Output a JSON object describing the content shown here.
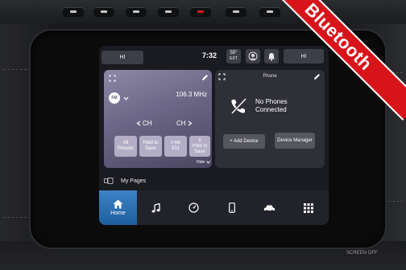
{
  "banner": {
    "label": "Bluetooth",
    "color": "#d8141b"
  },
  "bezel": {
    "label": "SCREEN OFF"
  },
  "status_bar": {
    "profile_label": "HI",
    "time": "7:32",
    "temperature": "55°",
    "temperature_unit": "EXT",
    "right_pill_label": "HI",
    "icons": [
      "driver-profile-icon",
      "notification-bell-icon"
    ]
  },
  "radio": {
    "band": "FM",
    "frequency": "106.3 MHz",
    "channel_down": "CH",
    "channel_up": "CH",
    "presets": [
      {
        "label": "All Presets"
      },
      {
        "label": "Hold to Save"
      },
      {
        "top": "2 AM",
        "label": "531"
      },
      {
        "top": "5",
        "label": "Hold to Save"
      }
    ],
    "hide_label": "Hide"
  },
  "phone": {
    "title": "Phone",
    "status": "No Phones Connected",
    "add_device": "+ Add Device",
    "device_manager": "Device Manager"
  },
  "my_pages": {
    "label": "My Pages"
  },
  "nav": {
    "active_color": "#2f74b8",
    "items": [
      {
        "label": "Home",
        "icon": "home-icon"
      },
      {
        "label": "",
        "icon": "music-note-icon"
      },
      {
        "label": "",
        "icon": "gauge-icon"
      },
      {
        "label": "",
        "icon": "phone-icon"
      },
      {
        "label": "",
        "icon": "car-icon"
      },
      {
        "label": "",
        "icon": "apps-grid-icon"
      }
    ]
  }
}
